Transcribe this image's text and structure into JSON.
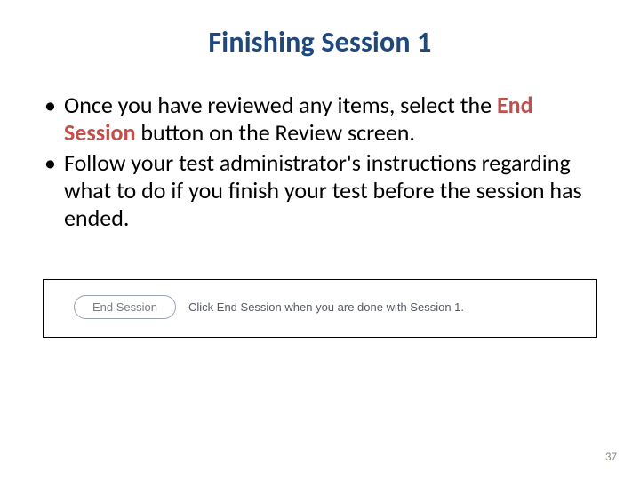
{
  "title": "Finishing Session 1",
  "bullets": {
    "b1": {
      "pre": "Once you have reviewed any items, select the ",
      "emph": "End Session",
      "post": " button on the Review screen."
    },
    "b2": "Follow your test administrator's instructions regarding what to do if you finish your test before the session has ended."
  },
  "figure": {
    "button_label": "End Session",
    "hint": "Click End Session when you are done with Session 1."
  },
  "page_number": "37"
}
